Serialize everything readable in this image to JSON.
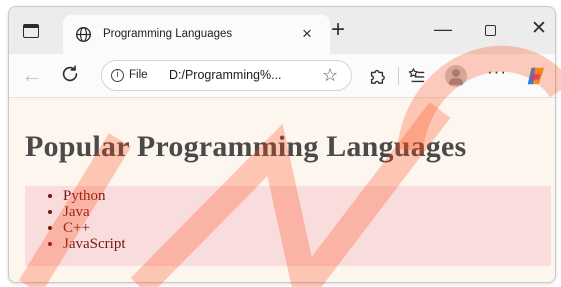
{
  "browser": {
    "tab": {
      "title": "Programming Languages",
      "close": "×"
    },
    "new_tab": "+",
    "window_controls": {
      "minimize": "—",
      "close": "✕"
    },
    "toolbar": {
      "back": "←",
      "address_scheme": "File",
      "address_url": "D:/Programming%...",
      "favorite_star": "☆",
      "more": "···"
    }
  },
  "page": {
    "heading": "Popular Programming Languages",
    "languages": [
      "Python",
      "Java",
      "C++",
      "JavaScript"
    ]
  },
  "colors": {
    "page_background": "#fdf6ee",
    "list_background": "#f9dcdc",
    "list_text": "#7a1515",
    "heading_text": "#4a4a4a"
  }
}
